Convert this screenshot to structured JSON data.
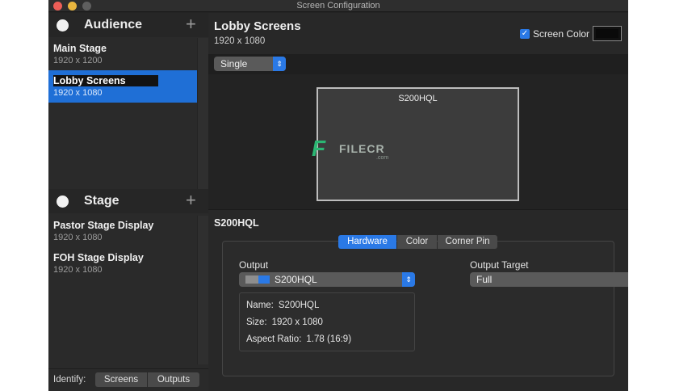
{
  "window": {
    "title": "Screen Configuration"
  },
  "sidebar": {
    "audience": {
      "label": "Audience",
      "add": "+",
      "items": [
        {
          "name": "Main Stage",
          "resolution": "1920 x 1200"
        },
        {
          "name": "Lobby Screens",
          "resolution": "1920 x 1080"
        }
      ]
    },
    "stage": {
      "label": "Stage",
      "add": "+",
      "items": [
        {
          "name": "Pastor Stage Display",
          "resolution": "1920 x 1080"
        },
        {
          "name": "FOH Stage Display",
          "resolution": "1920 x 1080"
        }
      ]
    },
    "identify": {
      "label": "Identify:",
      "screens": "Screens",
      "outputs": "Outputs"
    }
  },
  "main": {
    "title": "Lobby Screens",
    "resolution": "1920 x 1080",
    "screen_color_label": "Screen Color",
    "screen_color_checked": true,
    "screen_color_value": "#111111",
    "mode": "Single",
    "preview_screen": "S200HQL",
    "watermark": {
      "mark": "F",
      "text": "FILECR",
      "suffix": ".com"
    },
    "output_name": "S200HQL",
    "tabs": {
      "hardware": "Hardware",
      "color": "Color",
      "corner_pin": "Corner Pin"
    },
    "output_label": "Output",
    "output_value": "S200HQL",
    "target_label": "Output Target",
    "target_value": "Full",
    "info": {
      "name_label": "Name:",
      "name_value": "S200HQL",
      "size_label": "Size:",
      "size_value": "1920 x 1080",
      "aspect_label": "Aspect Ratio:",
      "aspect_value": "1.78 (16:9)"
    }
  },
  "colors": {
    "accent": "#2a79e6",
    "selection": "#1f6fd6"
  },
  "icons": {
    "chevron": "chevron-updown-icon",
    "check": "checkmark-icon"
  }
}
